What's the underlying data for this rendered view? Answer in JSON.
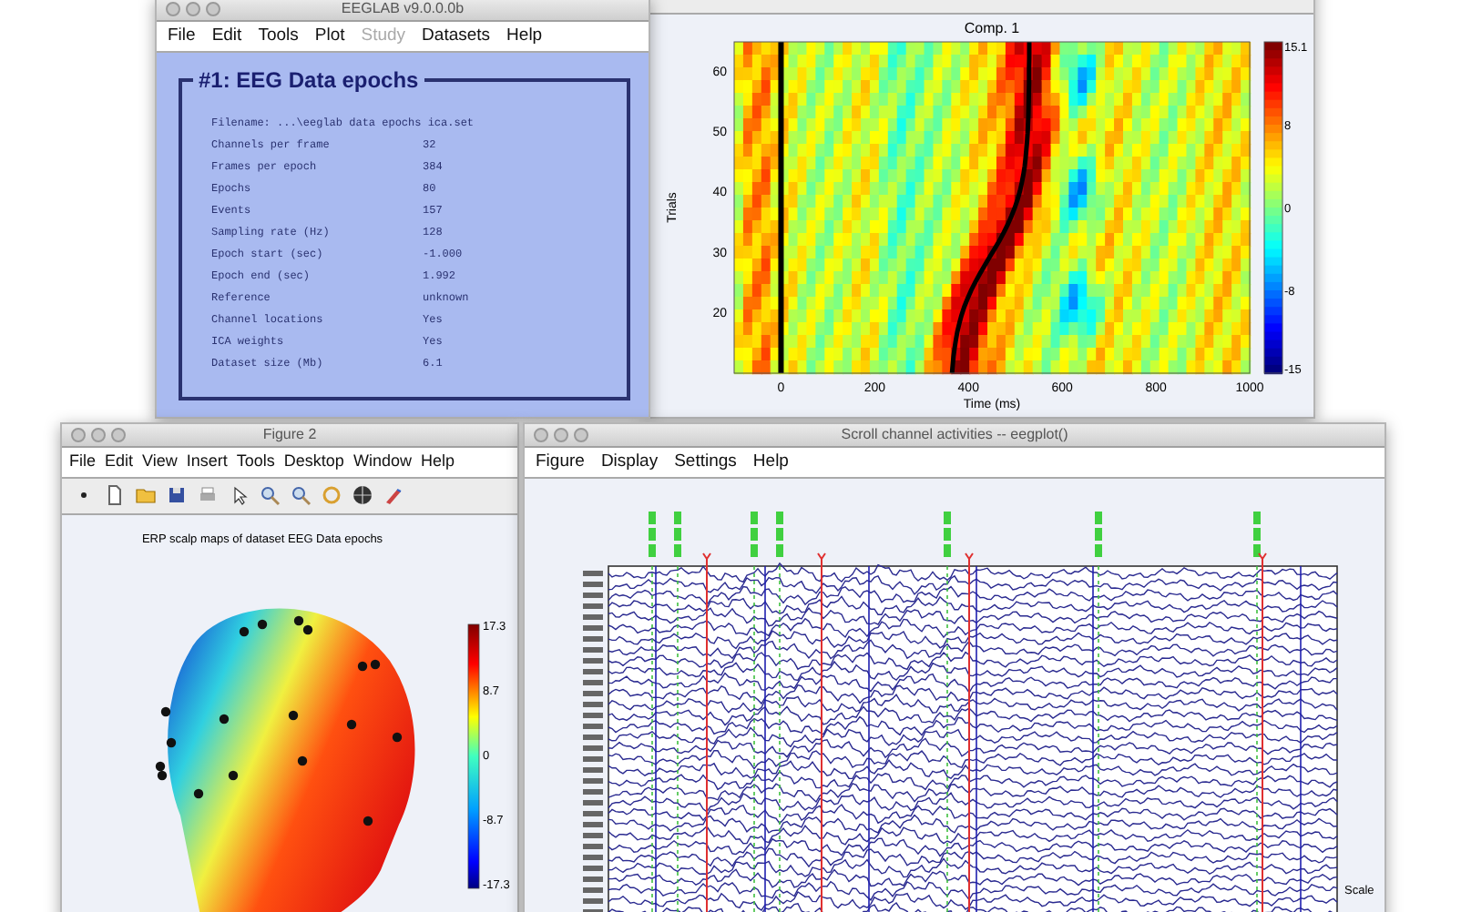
{
  "eeglab_window": {
    "title": "EEGLAB v9.0.0.0b",
    "menu": [
      {
        "label": "File",
        "disabled": false
      },
      {
        "label": "Edit",
        "disabled": false
      },
      {
        "label": "Tools",
        "disabled": false
      },
      {
        "label": "Plot",
        "disabled": false
      },
      {
        "label": "Study",
        "disabled": true
      },
      {
        "label": "Datasets",
        "disabled": false
      },
      {
        "label": "Help",
        "disabled": false
      }
    ],
    "panel_title": "#1: EEG Data epochs",
    "info_rows": [
      {
        "label": "Filename: ...\\eeglab data epochs ica.set",
        "value": ""
      },
      {
        "label": "Channels per frame",
        "value": "32"
      },
      {
        "label": "Frames per epoch",
        "value": "384"
      },
      {
        "label": "Epochs",
        "value": "80"
      },
      {
        "label": "Events",
        "value": "157"
      },
      {
        "label": "Sampling rate (Hz)",
        "value": "128"
      },
      {
        "label": "Epoch start (sec)",
        "value": "-1.000"
      },
      {
        "label": "Epoch end (sec)",
        "value": "1.992"
      },
      {
        "label": "Reference",
        "value": "unknown"
      },
      {
        "label": "Channel locations",
        "value": "Yes"
      },
      {
        "label": "ICA weights",
        "value": "Yes"
      },
      {
        "label": "Dataset size (Mb)",
        "value": "6.1"
      }
    ]
  },
  "erpimage_window": {
    "plot_title": "Comp. 1",
    "xlabel": "Time (ms)",
    "ylabel": "Trials",
    "xticks": [
      "0",
      "200",
      "400",
      "600",
      "800",
      "1000"
    ],
    "yticks": [
      "60",
      "50",
      "40",
      "30",
      "20"
    ],
    "colorbar_ticks": [
      "15.1",
      "8",
      "0",
      "-8",
      "-15"
    ]
  },
  "figure2_window": {
    "title": "Figure 2",
    "menu": [
      "File",
      "Edit",
      "View",
      "Insert",
      "Tools",
      "Desktop",
      "Window",
      "Help"
    ],
    "plot_title": "ERP scalp maps of dataset EEG Data epochs",
    "colorbar_ticks": [
      "17.3",
      "8.7",
      "0",
      "-8.7",
      "-17.3"
    ]
  },
  "scroll_window": {
    "title": "Scroll channel activities -- eegplot()",
    "menu": [
      "Figure",
      "Display",
      "Settings",
      "Help"
    ],
    "scale_label": "Scale"
  }
}
